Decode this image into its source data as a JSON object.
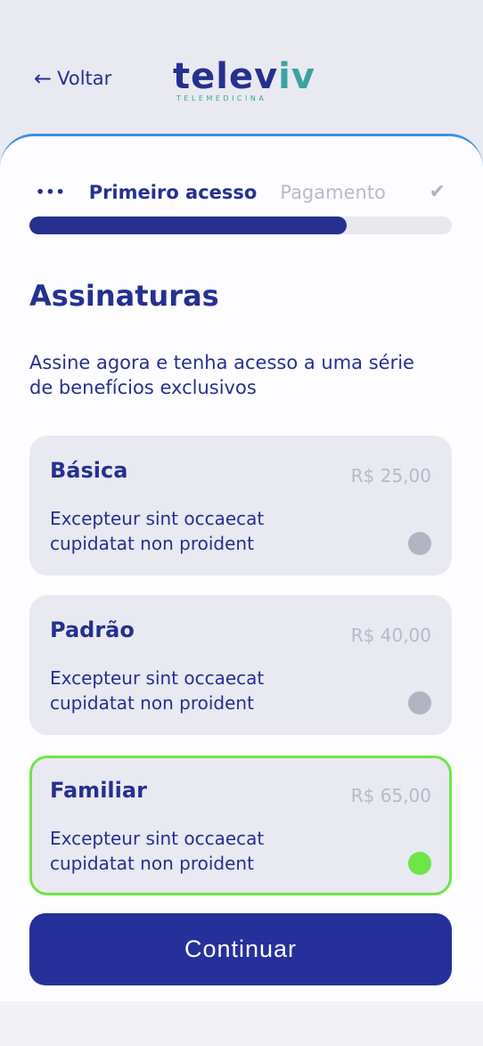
{
  "header": {
    "back_label": "Voltar",
    "logo_main": "telev",
    "logo_accent": "iv",
    "logo_subtitle": "TELEMEDICINA"
  },
  "steps": {
    "dots": "•••",
    "current": "Primeiro acesso",
    "next": "Pagamento",
    "done_icon": "check-icon",
    "progress_fraction": 0.75
  },
  "page": {
    "title": "Assinaturas",
    "description": "Assine agora e tenha acesso a uma série de benefícios exclusivos"
  },
  "plans": [
    {
      "name": "Básica",
      "price": "R$ 25,00",
      "text": "Excepteur sint occaecat cupidatat non proident",
      "selected": false
    },
    {
      "name": "Padrão",
      "price": "R$ 40,00",
      "text": "Excepteur sint occaecat cupidatat non proident",
      "selected": false
    },
    {
      "name": "Familiar",
      "price": "R$ 65,00",
      "text": "Excepteur sint occaecat cupidatat non proident",
      "selected": true
    }
  ],
  "actions": {
    "continue_label": "Continuar"
  },
  "colors": {
    "primary": "#26308f",
    "accent": "#3aa3a0",
    "selected": "#6ee548",
    "muted": "#b8b8c8",
    "card_border": "#3b8fe6"
  }
}
